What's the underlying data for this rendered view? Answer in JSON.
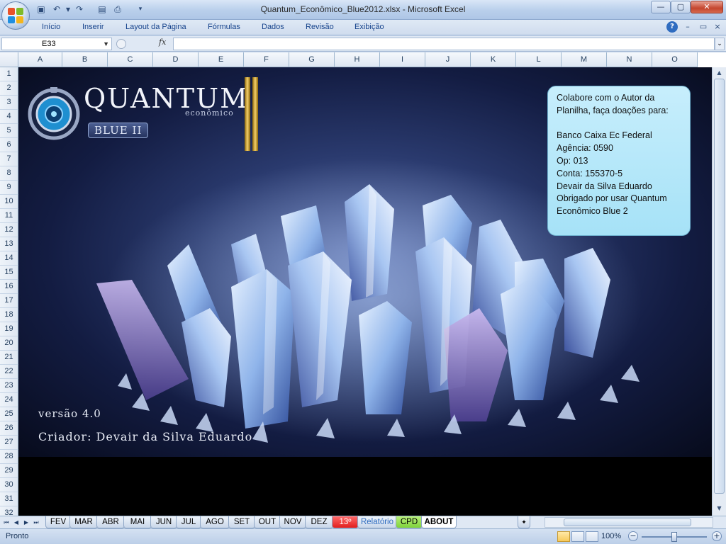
{
  "window": {
    "title": "Quantum_Econômico_Blue2012.xlsx - Microsoft Excel",
    "controls": {
      "minimize": "—",
      "maximize": "▢",
      "close": "✕"
    }
  },
  "quick_access": {
    "icons": [
      "save-icon",
      "undo-icon",
      "redo-icon",
      "print-preview-icon",
      "print-icon",
      "customize-icon"
    ]
  },
  "ribbon": {
    "tabs": [
      "Início",
      "Inserir",
      "Layout da Página",
      "Fórmulas",
      "Dados",
      "Revisão",
      "Exibição"
    ],
    "help": "?"
  },
  "formula_bar": {
    "cell_ref": "E33",
    "fx_label": "fx",
    "formula": ""
  },
  "grid": {
    "columns": [
      "A",
      "B",
      "C",
      "D",
      "E",
      "F",
      "G",
      "H",
      "I",
      "J",
      "K",
      "L",
      "M",
      "N",
      "O"
    ],
    "rows": [
      "1",
      "2",
      "3",
      "4",
      "5",
      "6",
      "7",
      "8",
      "9",
      "10",
      "11",
      "12",
      "13",
      "14",
      "15",
      "16",
      "17",
      "18",
      "19",
      "20",
      "21",
      "22",
      "23",
      "24",
      "25",
      "26",
      "27",
      "28",
      "29",
      "30",
      "31",
      "32"
    ]
  },
  "banner": {
    "logo_title": "QUANTUM",
    "logo_subtitle": "econômico",
    "logo_edition": "BLUE II",
    "version": "versão 4.0",
    "creator": "Criador: Devair da Silva Eduardo",
    "colors": {
      "background": "#0c1230",
      "crystal": "#9fc2ee",
      "gold": "#d5a21a"
    }
  },
  "donation": {
    "lines": [
      "Colabore com o Autor da",
      "Planilha, faça doações para:",
      "",
      "Banco Caixa Ec Federal",
      "Agência: 0590",
      "Op: 013",
      "Conta: 155370-5",
      "Devair da Silva Eduardo",
      "Obrigado por usar Quantum",
      "Econômico Blue 2"
    ]
  },
  "sheet_tabs": {
    "items": [
      {
        "label": "FEV",
        "style": "normal"
      },
      {
        "label": "MAR",
        "style": "normal"
      },
      {
        "label": "ABR",
        "style": "normal"
      },
      {
        "label": "MAI",
        "style": "normal"
      },
      {
        "label": "JUN",
        "style": "normal"
      },
      {
        "label": "JUL",
        "style": "normal"
      },
      {
        "label": "AGO",
        "style": "normal"
      },
      {
        "label": "SET",
        "style": "normal"
      },
      {
        "label": "OUT",
        "style": "normal"
      },
      {
        "label": "NOV",
        "style": "normal"
      },
      {
        "label": "DEZ",
        "style": "normal"
      },
      {
        "label": "13º",
        "style": "red"
      },
      {
        "label": "Relatório",
        "style": "blue"
      },
      {
        "label": "CPD",
        "style": "green"
      },
      {
        "label": "ABOUT",
        "style": "active"
      }
    ]
  },
  "status_bar": {
    "status": "Pronto",
    "zoom": "100%",
    "zoom_level": 1.0
  }
}
